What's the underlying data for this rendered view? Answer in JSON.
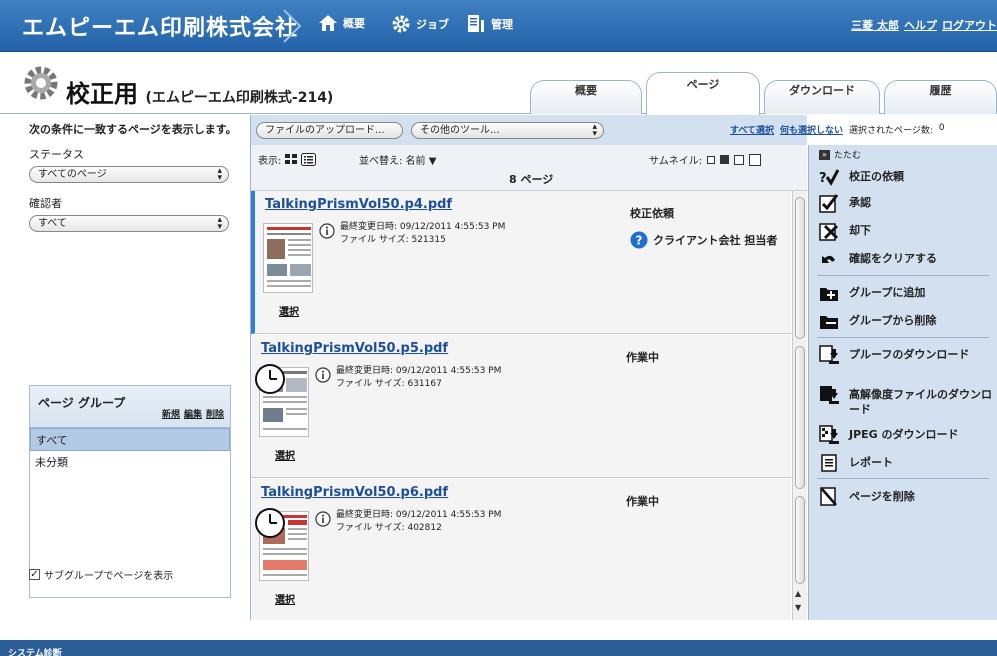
{
  "header": {
    "brand": "エムピーエム印刷株式会社",
    "nav": [
      {
        "label": "概要",
        "icon": "home-icon"
      },
      {
        "label": "ジョブ",
        "icon": "gear-icon"
      },
      {
        "label": "管理",
        "icon": "admin-icon"
      }
    ],
    "user_link": "三菱 太郎",
    "help_link": "ヘルプ",
    "logout_link": "ログアウト"
  },
  "page": {
    "title": "校正用",
    "subtitle": "(エムピーエム印刷株式-214)"
  },
  "tabs": [
    {
      "label": "概要",
      "active": false
    },
    {
      "label": "ページ",
      "active": true
    },
    {
      "label": "ダウンロード",
      "active": false
    },
    {
      "label": "履歴",
      "active": false
    }
  ],
  "filters": {
    "heading": "次の条件に一致するページを表示します。",
    "status_label": "ステータス",
    "status_value": "すべてのページ",
    "reviewer_label": "確認者",
    "reviewer_value": "すべて"
  },
  "page_groups": {
    "title": "ページ グループ",
    "new_link": "新規",
    "edit_link": "編集",
    "delete_link": "削除",
    "items": [
      {
        "label": "すべて",
        "selected": true
      },
      {
        "label": "未分類",
        "selected": false
      }
    ],
    "subgroup_checkbox_label": "サブグループでページを表示",
    "subgroup_checked": true
  },
  "toolbar": {
    "upload_button": "ファイルのアップロード...",
    "tools_select": "その他のツール...",
    "select_all": "すべて選択",
    "select_none": "何も選択しない",
    "selected_count_label": "選択されたページ数:",
    "selected_count": "0"
  },
  "view": {
    "display_label": "表示:",
    "sort_label": "並べ替え: 名前",
    "thumbnail_label": "サムネイル:",
    "page_count": "8 ページ"
  },
  "pages": [
    {
      "filename": "TalkingPrismVol50.p4.pdf",
      "modified": "最終変更日時: 09/12/2011 4:55:53 PM",
      "filesize": "ファイル サイズ: 521315",
      "status": "校正依頼",
      "assignee": "クライアント会社 担当者",
      "select_label": "選択"
    },
    {
      "filename": "TalkingPrismVol50.p5.pdf",
      "modified": "最終変更日時: 09/12/2011 4:55:53 PM",
      "filesize": "ファイル サイズ: 631167",
      "status": "作業中",
      "select_label": "選択"
    },
    {
      "filename": "TalkingPrismVol50.p6.pdf",
      "modified": "最終変更日時: 09/12/2011 4:55:53 PM",
      "filesize": "ファイル サイズ: 402812",
      "status": "作業中",
      "select_label": "選択"
    }
  ],
  "actions": {
    "collapse_label": "たたむ",
    "request_proof": "校正の依頼",
    "approve": "承認",
    "reject": "却下",
    "clear_review": "確認をクリアする",
    "add_to_group": "グループに追加",
    "remove_from_group": "グループから削除",
    "download_proof": "プルーフのダウンロード",
    "download_hires": "高解像度ファイルのダウンロード",
    "download_jpeg": "JPEG のダウンロード",
    "report": "レポート",
    "delete_pages": "ページを削除"
  },
  "footer": {
    "label": "システム診断"
  },
  "colors": {
    "header_blue": "#2f70b6",
    "panel_blue": "#d2e0ef",
    "link_blue": "#1d4f9a",
    "selected_row_accent": "#2f7ed8"
  }
}
